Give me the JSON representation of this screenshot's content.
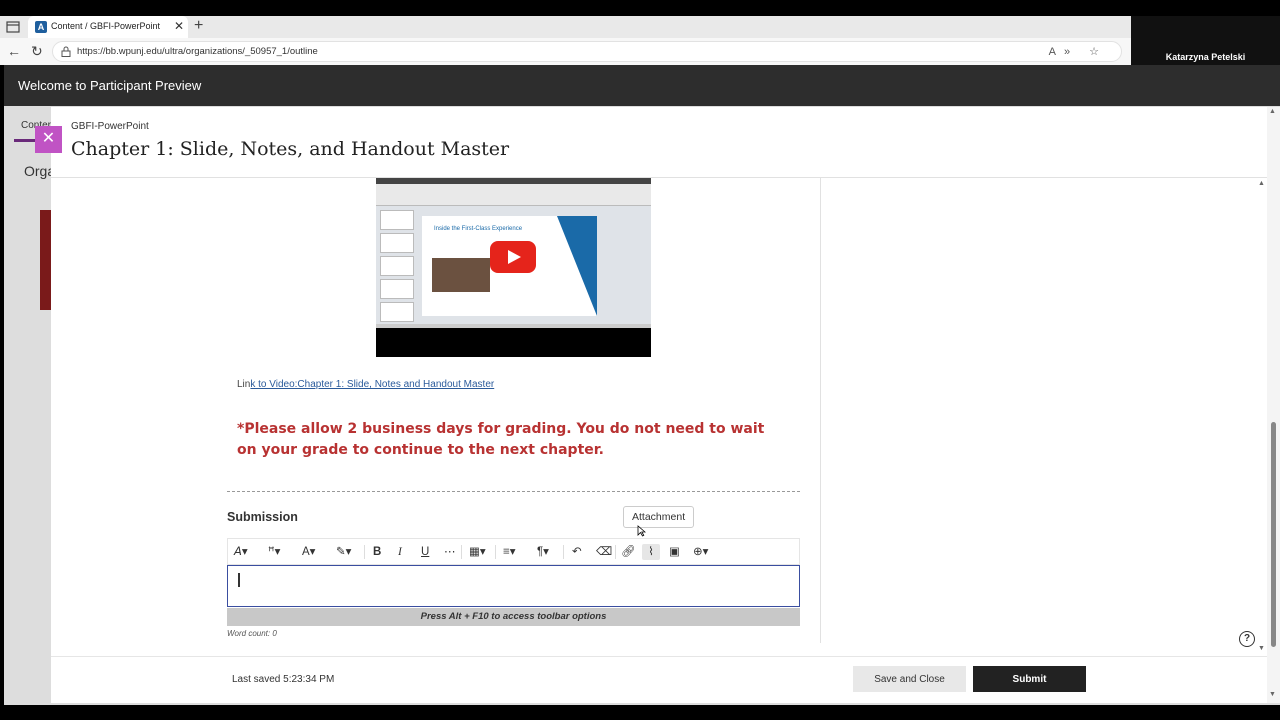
{
  "browser": {
    "tab_title": "Content / GBFI-PowerPoint",
    "tab_favicon": "A",
    "url": "https://bb.wpunj.edu/ultra/organizations/_50957_1/outline"
  },
  "presenter": {
    "name": "Katarzyna Petelski"
  },
  "appbar": {
    "title": "Welcome to Participant Preview"
  },
  "background": {
    "tab_label": "Conter",
    "org_label": "Orga"
  },
  "panel": {
    "breadcrumb": "GBFI-PowerPoint",
    "title": "Chapter 1: Slide, Notes, and Handout Master"
  },
  "video": {
    "slide_heading": "Inside the First-Class Experience"
  },
  "content": {
    "link_prefix": "Lin",
    "link_text": "k to Video:Chapter 1: Slide, Notes and Handout Master",
    "grading_note": "*Please allow 2 business days for grading. You do not need to wait on your grade to continue to the next chapter."
  },
  "submission": {
    "label": "Submission",
    "tooltip": "Attachment",
    "hint": "Press Alt + F10 to access toolbar options",
    "word_count": "Word count: 0"
  },
  "footer": {
    "last_saved": "Last saved 5:23:34 PM",
    "save_close_label": "Save and Close",
    "submit_label": "Submit"
  },
  "colors": {
    "accent": "#c053c4",
    "warning_text": "#b83232",
    "submit_bg": "#222222",
    "link": "#2b5b9b"
  }
}
